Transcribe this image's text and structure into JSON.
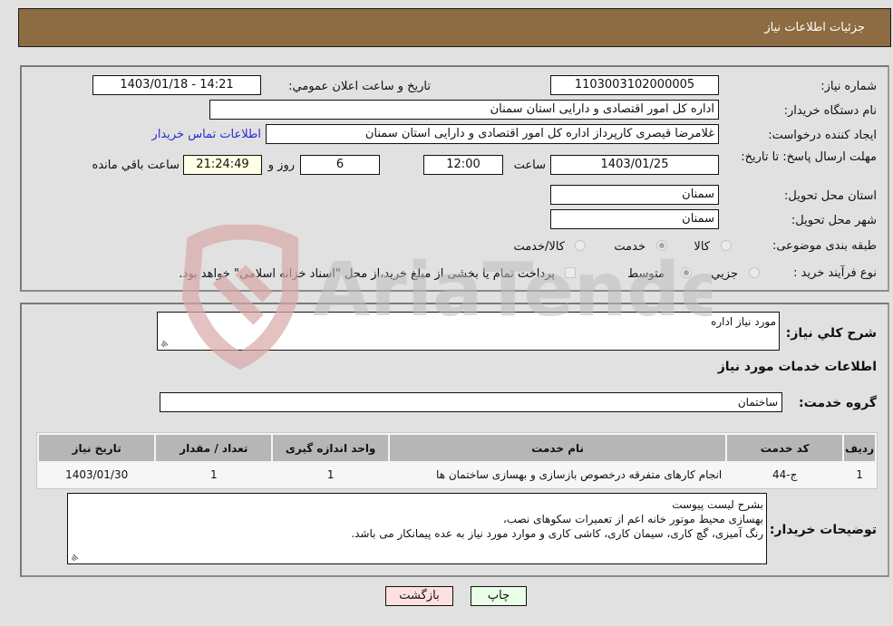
{
  "header": {
    "title": "جزئیات اطلاعات نیاز"
  },
  "form": {
    "need_number": {
      "label": "شماره نیاز:",
      "value": "1103003102000005"
    },
    "announce_datetime": {
      "label": "تاريخ و ساعت اعلان عمومي:",
      "value": "1403/01/18 - 14:21"
    },
    "buyer_org": {
      "label": "نام دستگاه خریدار:",
      "value": "اداره کل امور اقتصادی و دارایی استان سمنان"
    },
    "requester": {
      "label": "ایجاد کننده درخواست:",
      "value": "غلامرضا قیصری کارپرداز اداره کل امور اقتصادی و دارایی استان سمنان",
      "contact_link": "اطلاعات تماس خریدار"
    },
    "deadline": {
      "label": "مهلت ارسال پاسخ: تا تاریخ:",
      "date": "1403/01/25",
      "time_label": "ساعت",
      "time": "12:00",
      "days": "6",
      "days_label": "روز و",
      "remaining": "21:24:49",
      "remaining_label": "ساعت باقي مانده"
    },
    "delivery_province": {
      "label": "استان محل تحویل:",
      "value": "سمنان"
    },
    "delivery_city": {
      "label": "شهر محل تحویل:",
      "value": "سمنان"
    },
    "category": {
      "label": "طبقه بندی موضوعی:",
      "options": [
        "کالا",
        "خدمت",
        "کالا/خدمت"
      ],
      "selected": "خدمت"
    },
    "purchase_type": {
      "label": "نوع فرآیند خرید :",
      "options": [
        "جزيي",
        "متوسط"
      ],
      "selected": "متوسط",
      "treasury_note": "پرداخت تمام یا بخشی از مبلغ خرید،از محل \"اسناد خزانه اسلامی\" خواهد بود.",
      "treasury_checked": false
    }
  },
  "details": {
    "summary_label": "شرح کلي نياز:",
    "summary_value": "مورد نیاز اداره",
    "services_heading": "اطلاعات خدمات مورد نیاز",
    "service_group_label": "گروه خدمت:",
    "service_group_value": "ساختمان",
    "table": {
      "columns": [
        "ردیف",
        "کد خدمت",
        "نام خدمت",
        "واحد اندازه گیری",
        "تعداد / مقدار",
        "تاریخ نیاز"
      ],
      "rows": [
        [
          "1",
          "ج-44",
          "انجام کارهای متفرقه درخصوص بازسازی و بهسازی ساختمان ها",
          "1",
          "1",
          "1403/01/30"
        ]
      ]
    },
    "buyer_notes_label": "توضیحات خریدار:",
    "buyer_notes_lines": [
      "بشرح لیست پیوست",
      "بهسازی محیط موتور خانه اعم از تعمیرات سکوهای نصب،",
      "رنگ آمیزی، گچ کاری، سیمان کاری، کاشی کاری و موارد مورد نیاز به عده پیمانکار می باشد."
    ]
  },
  "buttons": {
    "print": "چاپ",
    "back": "بازگشت"
  },
  "watermark": {
    "text": "AriaTender.neT"
  },
  "colors": {
    "header": "#8d6c43",
    "print_button": "#eaffe8",
    "back_button": "#ffe0e0",
    "link": "#2b2bd1"
  }
}
